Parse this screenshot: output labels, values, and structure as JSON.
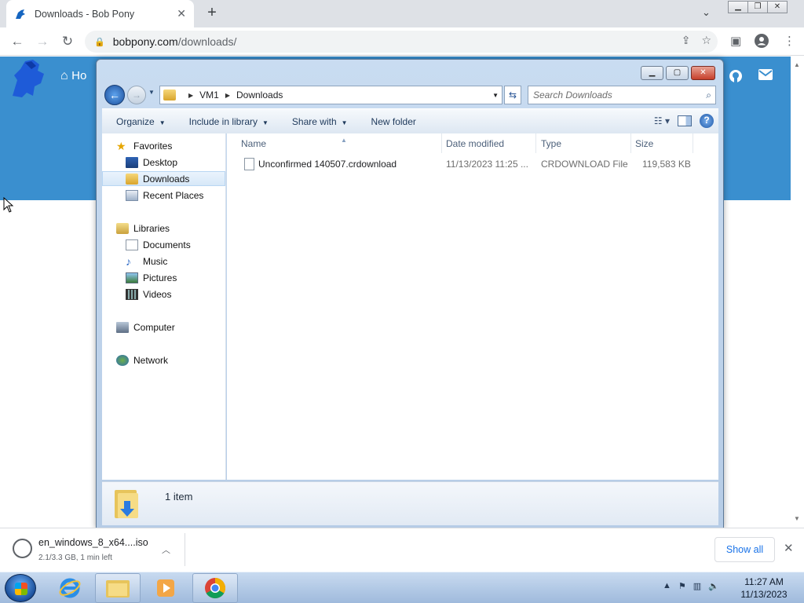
{
  "browser": {
    "tab_title": "Downloads - Bob Pony",
    "url_domain": "bobpony.com",
    "url_path": "/downloads/",
    "new_tab": "+",
    "tab_close": "✕"
  },
  "page": {
    "home_label": "Ho"
  },
  "explorer": {
    "breadcrumb": [
      "VM1",
      "Downloads"
    ],
    "search_placeholder": "Search Downloads",
    "commands": {
      "organize": "Organize",
      "include": "Include in library",
      "share": "Share with",
      "new_folder": "New folder"
    },
    "nav": {
      "favorites": "Favorites",
      "desktop": "Desktop",
      "downloads": "Downloads",
      "recent": "Recent Places",
      "libraries": "Libraries",
      "documents": "Documents",
      "music": "Music",
      "pictures": "Pictures",
      "videos": "Videos",
      "computer": "Computer",
      "network": "Network"
    },
    "columns": {
      "name": "Name",
      "date": "Date modified",
      "type": "Type",
      "size": "Size"
    },
    "files": [
      {
        "name": "Unconfirmed 140507.crdownload",
        "date": "11/13/2023 11:25 ...",
        "type": "CRDOWNLOAD File",
        "size": "119,583 KB"
      }
    ],
    "item_count": "1 item"
  },
  "download_shelf": {
    "file_name": "en_windows_8_x64....iso",
    "status": "2.1/3.3 GB, 1 min left",
    "show_all": "Show all"
  },
  "taskbar": {
    "time": "11:27 AM",
    "date": "11/13/2023"
  },
  "colors": {
    "hero_blue": "#3a8fcf",
    "link_blue": "#1a73e8",
    "aero_frame": "#c9dcf1"
  }
}
